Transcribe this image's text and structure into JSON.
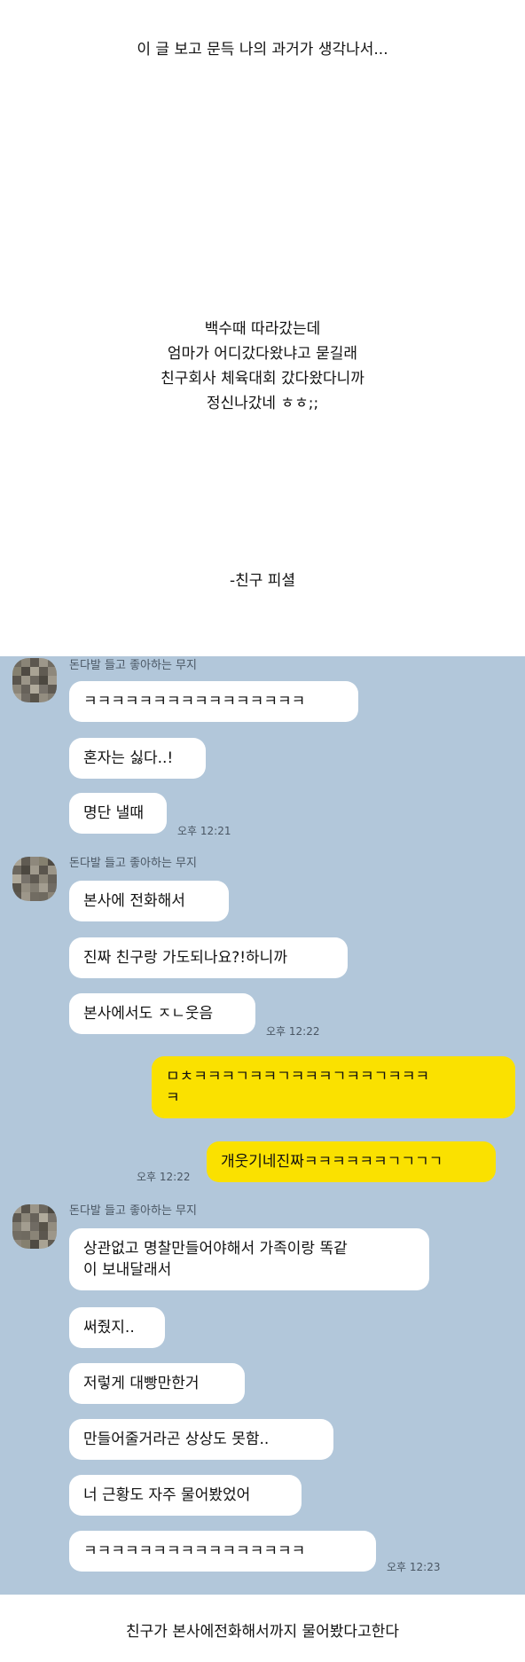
{
  "intro": {
    "title": "이 글 보고 문득 나의 과거가 생각나서...",
    "story": [
      "백수때 따라갔는데",
      "엄마가 어디갔다왔냐고 묻길래",
      "친구회사 체육대회 갔다왔다니까",
      "정신나갔네 ㅎㅎ;;"
    ],
    "signature": "-친구 피셜"
  },
  "chat": {
    "background": "#b2c7da",
    "incoming_bubble_color": "#ffffff",
    "outgoing_bubble_color": "#fae100",
    "sender_name": "돈다발 들고 좋아하는 무지",
    "group1": {
      "messages": [
        "ㅋㅋㅋㅋㅋㅋㅋㅋㅋㅋㅋㅋㅋㅋㅋㅋ",
        "혼자는 싫다..!",
        "명단 낼때"
      ],
      "time": "오후 12:21"
    },
    "group2": {
      "messages": [
        "본사에 전화해서",
        "진짜 친구랑 가도되나요?!하니까",
        "본사에서도 ㅈㄴ웃음"
      ],
      "time": "오후 12:22"
    },
    "mine": {
      "messages": [
        "ㅁㅊㅋㅋㅋㄱㅋㅋㄱㅋㅋㅋㄱㅋㅋㄱㅋㅋㅋ\nㅋ",
        "개웃기네진짜ㅋㅋㅋㅋㅋㅋㄱㄱㄱㄱ"
      ],
      "time": "오후 12:22"
    },
    "group3": {
      "messages": [
        "상관없고 명찰만들어야해서 가족이랑 똑같\n이 보내달래서",
        "써줬지..",
        "저렇게 대빵만한거",
        "만들어줄거라곤 상상도 못함..",
        "너 근황도 자주 물어봤었어",
        "ㅋㅋㅋㅋㅋㅋㅋㅋㅋㅋㅋㅋㅋㅋㅋㅋ"
      ],
      "time": "오후 12:23"
    }
  },
  "outro": {
    "caption": "친구가 본사에전화해서까지 물어봤다고한다"
  }
}
